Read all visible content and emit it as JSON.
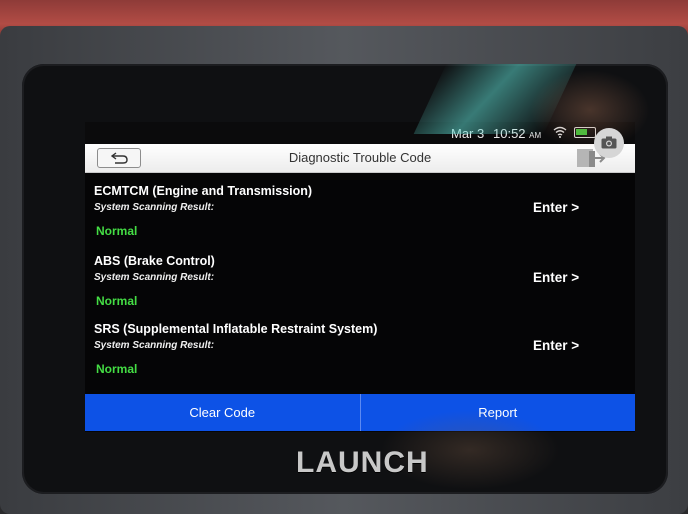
{
  "status_bar": {
    "date": "Mar 3",
    "time": "10:52",
    "ampm": "AM"
  },
  "header": {
    "title": "Diagnostic Trouble Code"
  },
  "systems": [
    {
      "name": "ECMTCM (Engine and Transmission)",
      "result_label": "System Scanning Result:",
      "result": "Normal",
      "action": "Enter >"
    },
    {
      "name": "ABS (Brake Control)",
      "result_label": "System Scanning Result:",
      "result": "Normal",
      "action": "Enter >"
    },
    {
      "name": "SRS (Supplemental Inflatable Restraint System)",
      "result_label": "System Scanning Result:",
      "result": "Normal",
      "action": "Enter >"
    }
  ],
  "footer": {
    "clear_label": "Clear Code",
    "report_label": "Report"
  },
  "device": {
    "brand": "LAUNCH"
  },
  "colors": {
    "accent": "#0d52e6",
    "status_ok": "#44dd44",
    "battery": "#3fc53a"
  }
}
